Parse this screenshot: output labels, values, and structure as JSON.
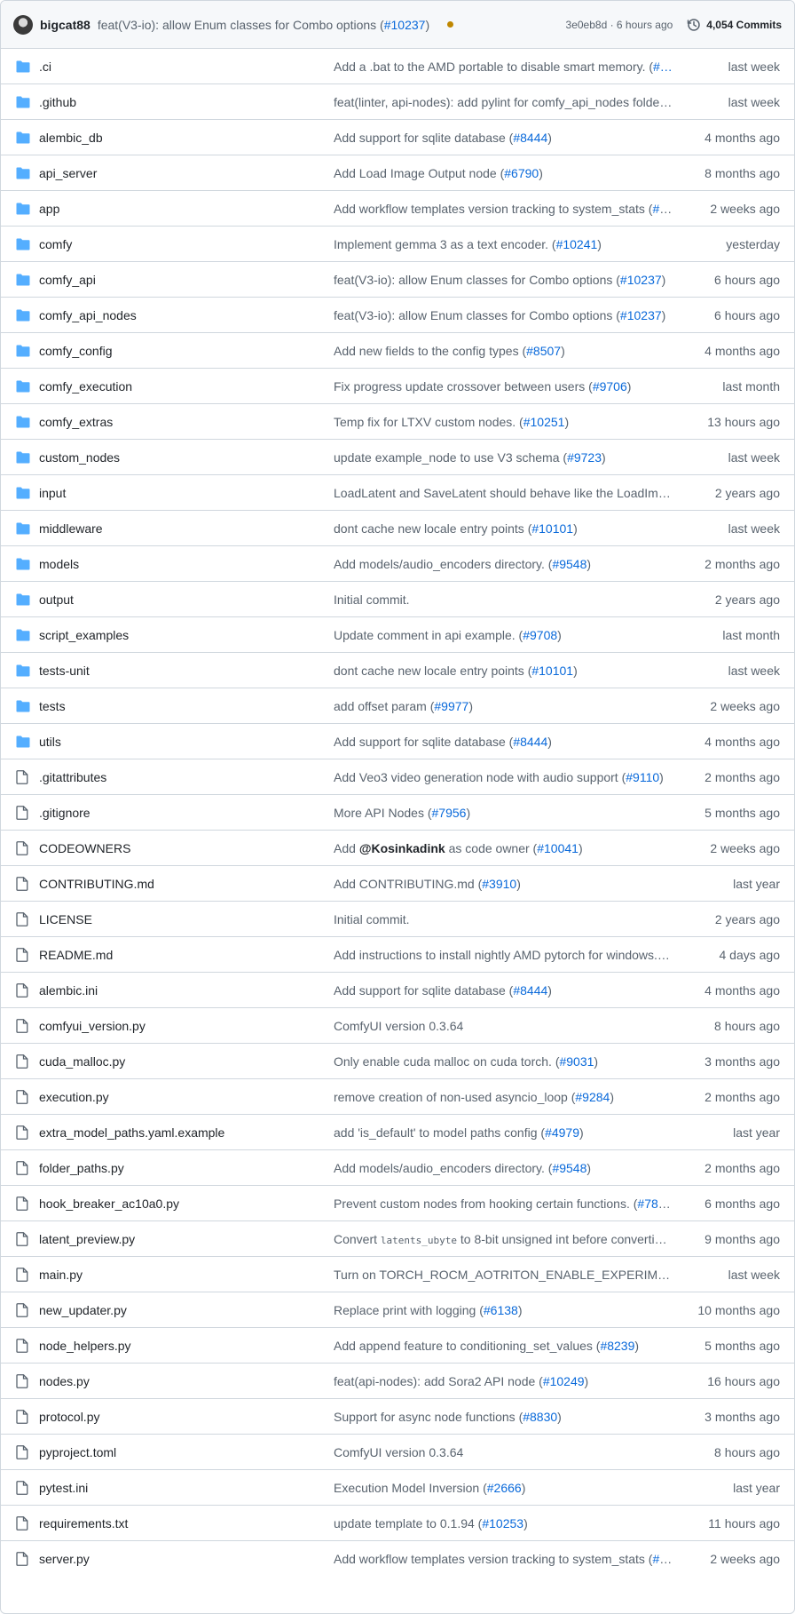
{
  "header": {
    "author": "bigcat88",
    "message": "feat(V3-io): allow Enum classes for Combo options (",
    "message_link": "#10237",
    "message_end": ")",
    "commit_meta": "3e0eb8d · 6 hours ago",
    "commits_label": "4,054 Commits",
    "status_color": "#bf8700"
  },
  "rows": [
    {
      "type": "folder",
      "name": ".ci",
      "msg": "Add a .bat to the AMD portable to disable smart memory. (",
      "link": "#…",
      "end": "",
      "age": "last week"
    },
    {
      "type": "folder",
      "name": ".github",
      "msg": "feat(linter, api-nodes): add pylint for comfy_api_nodes folder…",
      "link": "",
      "end": "",
      "age": "last week"
    },
    {
      "type": "folder",
      "name": "alembic_db",
      "msg": "Add support for sqlite database (",
      "link": "#8444",
      "end": ")",
      "age": "4 months ago"
    },
    {
      "type": "folder",
      "name": "api_server",
      "msg": "Add Load Image Output node (",
      "link": "#6790",
      "end": ")",
      "age": "8 months ago"
    },
    {
      "type": "folder",
      "name": "app",
      "msg": "Add workflow templates version tracking to system_stats (",
      "link": "#9…",
      "end": "",
      "age": "2 weeks ago"
    },
    {
      "type": "folder",
      "name": "comfy",
      "msg": "Implement gemma 3 as a text encoder. (",
      "link": "#10241",
      "end": ")",
      "age": "yesterday"
    },
    {
      "type": "folder",
      "name": "comfy_api",
      "msg": "feat(V3-io): allow Enum classes for Combo options (",
      "link": "#10237",
      "end": ")",
      "age": "6 hours ago"
    },
    {
      "type": "folder",
      "name": "comfy_api_nodes",
      "msg": "feat(V3-io): allow Enum classes for Combo options (",
      "link": "#10237",
      "end": ")",
      "age": "6 hours ago"
    },
    {
      "type": "folder",
      "name": "comfy_config",
      "msg": "Add new fields to the config types (",
      "link": "#8507",
      "end": ")",
      "age": "4 months ago"
    },
    {
      "type": "folder",
      "name": "comfy_execution",
      "msg": "Fix progress update crossover between users (",
      "link": "#9706",
      "end": ")",
      "age": "last month"
    },
    {
      "type": "folder",
      "name": "comfy_extras",
      "msg": "Temp fix for LTXV custom nodes. (",
      "link": "#10251",
      "end": ")",
      "age": "13 hours ago"
    },
    {
      "type": "folder",
      "name": "custom_nodes",
      "msg": "update example_node to use V3 schema (",
      "link": "#9723",
      "end": ")",
      "age": "last week"
    },
    {
      "type": "folder",
      "name": "input",
      "msg": "LoadLatent and SaveLatent should behave like the LoadIma…",
      "link": "",
      "end": "",
      "age": "2 years ago"
    },
    {
      "type": "folder",
      "name": "middleware",
      "msg": "dont cache new locale entry points (",
      "link": "#10101",
      "end": ")",
      "age": "last week"
    },
    {
      "type": "folder",
      "name": "models",
      "msg": "Add models/audio_encoders directory. (",
      "link": "#9548",
      "end": ")",
      "age": "2 months ago"
    },
    {
      "type": "folder",
      "name": "output",
      "msg": "Initial commit.",
      "link": "",
      "end": "",
      "age": "2 years ago"
    },
    {
      "type": "folder",
      "name": "script_examples",
      "msg": "Update comment in api example. (",
      "link": "#9708",
      "end": ")",
      "age": "last month"
    },
    {
      "type": "folder",
      "name": "tests-unit",
      "msg": "dont cache new locale entry points (",
      "link": "#10101",
      "end": ")",
      "age": "last week"
    },
    {
      "type": "folder",
      "name": "tests",
      "msg": "add offset param (",
      "link": "#9977",
      "end": ")",
      "age": "2 weeks ago"
    },
    {
      "type": "folder",
      "name": "utils",
      "msg": "Add support for sqlite database (",
      "link": "#8444",
      "end": ")",
      "age": "4 months ago"
    },
    {
      "type": "file",
      "name": ".gitattributes",
      "msg": "Add Veo3 video generation node with audio support (",
      "link": "#9110",
      "end": ")",
      "age": "2 months ago"
    },
    {
      "type": "file",
      "name": ".gitignore",
      "msg": "More API Nodes (",
      "link": "#7956",
      "end": ")",
      "age": "5 months ago"
    },
    {
      "type": "file",
      "name": "CODEOWNERS",
      "msg": "Add ",
      "bold": "@Kosinkadink",
      "msg2": " as code owner (",
      "link": "#10041",
      "end": ")",
      "age": "2 weeks ago"
    },
    {
      "type": "file",
      "name": "CONTRIBUTING.md",
      "msg": "Add CONTRIBUTING.md (",
      "link": "#3910",
      "end": ")",
      "age": "last year"
    },
    {
      "type": "file",
      "name": "LICENSE",
      "msg": "Initial commit.",
      "link": "",
      "end": "",
      "age": "2 years ago"
    },
    {
      "type": "file",
      "name": "README.md",
      "msg": "Add instructions to install nightly AMD pytorch for windows.…",
      "link": "",
      "end": "",
      "age": "4 days ago"
    },
    {
      "type": "file",
      "name": "alembic.ini",
      "msg": "Add support for sqlite database (",
      "link": "#8444",
      "end": ")",
      "age": "4 months ago"
    },
    {
      "type": "file",
      "name": "comfyui_version.py",
      "msg": "ComfyUI version 0.3.64",
      "link": "",
      "end": "",
      "age": "8 hours ago"
    },
    {
      "type": "file",
      "name": "cuda_malloc.py",
      "msg": "Only enable cuda malloc on cuda torch. (",
      "link": "#9031",
      "end": ")",
      "age": "3 months ago"
    },
    {
      "type": "file",
      "name": "execution.py",
      "msg": "remove creation of non-used asyncio_loop (",
      "link": "#9284",
      "end": ")",
      "age": "2 months ago"
    },
    {
      "type": "file",
      "name": "extra_model_paths.yaml.example",
      "msg": "add 'is_default' to model paths config (",
      "link": "#4979",
      "end": ")",
      "age": "last year"
    },
    {
      "type": "file",
      "name": "folder_paths.py",
      "msg": "Add models/audio_encoders directory. (",
      "link": "#9548",
      "end": ")",
      "age": "2 months ago"
    },
    {
      "type": "file",
      "name": "hook_breaker_ac10a0.py",
      "msg": "Prevent custom nodes from hooking certain functions. (",
      "link": "#782…",
      "end": "",
      "age": "6 months ago"
    },
    {
      "type": "file",
      "name": "latent_preview.py",
      "msg": "Convert ",
      "code": "latents_ubyte",
      "msg2": " to 8-bit unsigned int before converti…",
      "link": "",
      "end": "",
      "age": "9 months ago"
    },
    {
      "type": "file",
      "name": "main.py",
      "msg": "Turn on TORCH_ROCM_AOTRITON_ENABLE_EXPERIMENTAL …",
      "link": "",
      "end": "",
      "age": "last week"
    },
    {
      "type": "file",
      "name": "new_updater.py",
      "msg": "Replace print with logging (",
      "link": "#6138",
      "end": ")",
      "age": "10 months ago"
    },
    {
      "type": "file",
      "name": "node_helpers.py",
      "msg": "Add append feature to conditioning_set_values (",
      "link": "#8239",
      "end": ")",
      "age": "5 months ago"
    },
    {
      "type": "file",
      "name": "nodes.py",
      "msg": "feat(api-nodes): add Sora2 API node (",
      "link": "#10249",
      "end": ")",
      "age": "16 hours ago"
    },
    {
      "type": "file",
      "name": "protocol.py",
      "msg": "Support for async node functions (",
      "link": "#8830",
      "end": ")",
      "age": "3 months ago"
    },
    {
      "type": "file",
      "name": "pyproject.toml",
      "msg": "ComfyUI version 0.3.64",
      "link": "",
      "end": "",
      "age": "8 hours ago"
    },
    {
      "type": "file",
      "name": "pytest.ini",
      "msg": "Execution Model Inversion (",
      "link": "#2666",
      "end": ")",
      "age": "last year"
    },
    {
      "type": "file",
      "name": "requirements.txt",
      "msg": "update template to 0.1.94 (",
      "link": "#10253",
      "end": ")",
      "age": "11 hours ago"
    },
    {
      "type": "file",
      "name": "server.py",
      "msg": "Add workflow templates version tracking to system_stats (",
      "link": "#9…",
      "end": "",
      "age": "2 weeks ago"
    }
  ],
  "colors": {
    "folder_icon": "#54aeff",
    "file_icon": "#59636e",
    "link": "#0969da",
    "muted": "#59636e"
  }
}
